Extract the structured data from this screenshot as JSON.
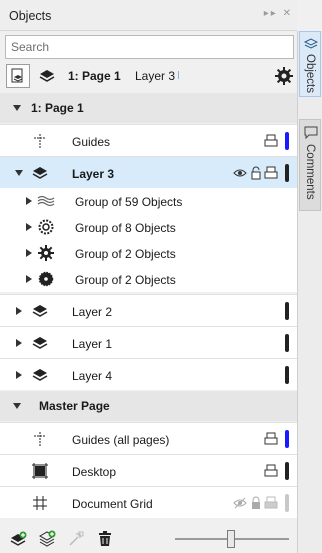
{
  "panel": {
    "title": "Objects",
    "search_placeholder": "Search",
    "current_page": "1: Page 1",
    "current_layer": "Layer 3"
  },
  "tree": {
    "page1": {
      "label": "1: Page 1",
      "guides": {
        "label": "Guides",
        "color": "#1a1aff"
      },
      "layer3": {
        "label": "Layer 3",
        "color": "#222222",
        "children": [
          {
            "label": "Group of 59 Objects",
            "icon": "group-icon"
          },
          {
            "label": "Group of 8 Objects",
            "icon": "gear-ring-icon"
          },
          {
            "label": "Group of 2 Objects",
            "icon": "gear-icon"
          },
          {
            "label": "Group of 2 Objects",
            "icon": "cog-icon"
          }
        ]
      },
      "layer2": {
        "label": "Layer 2",
        "color": "#222222"
      },
      "layer1": {
        "label": "Layer 1",
        "color": "#222222"
      },
      "layer4": {
        "label": "Layer 4",
        "color": "#222222"
      }
    },
    "master": {
      "label": "Master Page",
      "guides_all": {
        "label": "Guides (all pages)",
        "color": "#1a1aff"
      },
      "desktop": {
        "label": "Desktop",
        "color": "#222222"
      },
      "document_grid": {
        "label": "Document Grid",
        "color": "#c8c8c8"
      }
    }
  },
  "docker_tabs": [
    {
      "label": "Objects",
      "icon": "layers-icon",
      "active": true
    },
    {
      "label": "Comments",
      "icon": "comment-icon",
      "active": false
    }
  ],
  "colors": {
    "selected_row": "#d8ebfb",
    "header_row": "#e6e6e6",
    "guide_color": "#1a1aff"
  }
}
